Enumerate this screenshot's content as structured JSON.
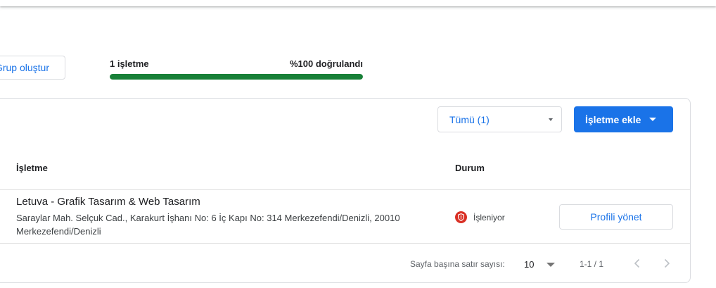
{
  "toolbar": {
    "create_group_label": "Grup oluştur"
  },
  "summary": {
    "business_count_label": "1 işletme",
    "verified_label": "%100 doğrulandı",
    "verified_fraction": 1.0
  },
  "filter": {
    "selected": "Tümü (1)"
  },
  "add_button": {
    "label": "İşletme ekle"
  },
  "table": {
    "columns": {
      "business": "İşletme",
      "status": "Durum"
    },
    "rows": [
      {
        "name": "Letuva - Grafik Tasarım & Web Tasarım",
        "address": "Saraylar Mah. Selçuk Cad., Karakurt İşhanı No: 6 İç Kapı No: 314 Merkezefendi/Denizli, 20010 Merkezefendi/Denizli",
        "status": "İşleniyor",
        "status_icon": "shield-alert-icon",
        "action_label": "Profili yönet"
      }
    ]
  },
  "pagination": {
    "rows_per_page_label": "Sayfa başına satır sayısı:",
    "rows_per_page": "10",
    "range": "1-1 / 1"
  },
  "colors": {
    "accent": "#1a73e8",
    "progress": "#188038",
    "status_alert": "#d93025"
  }
}
